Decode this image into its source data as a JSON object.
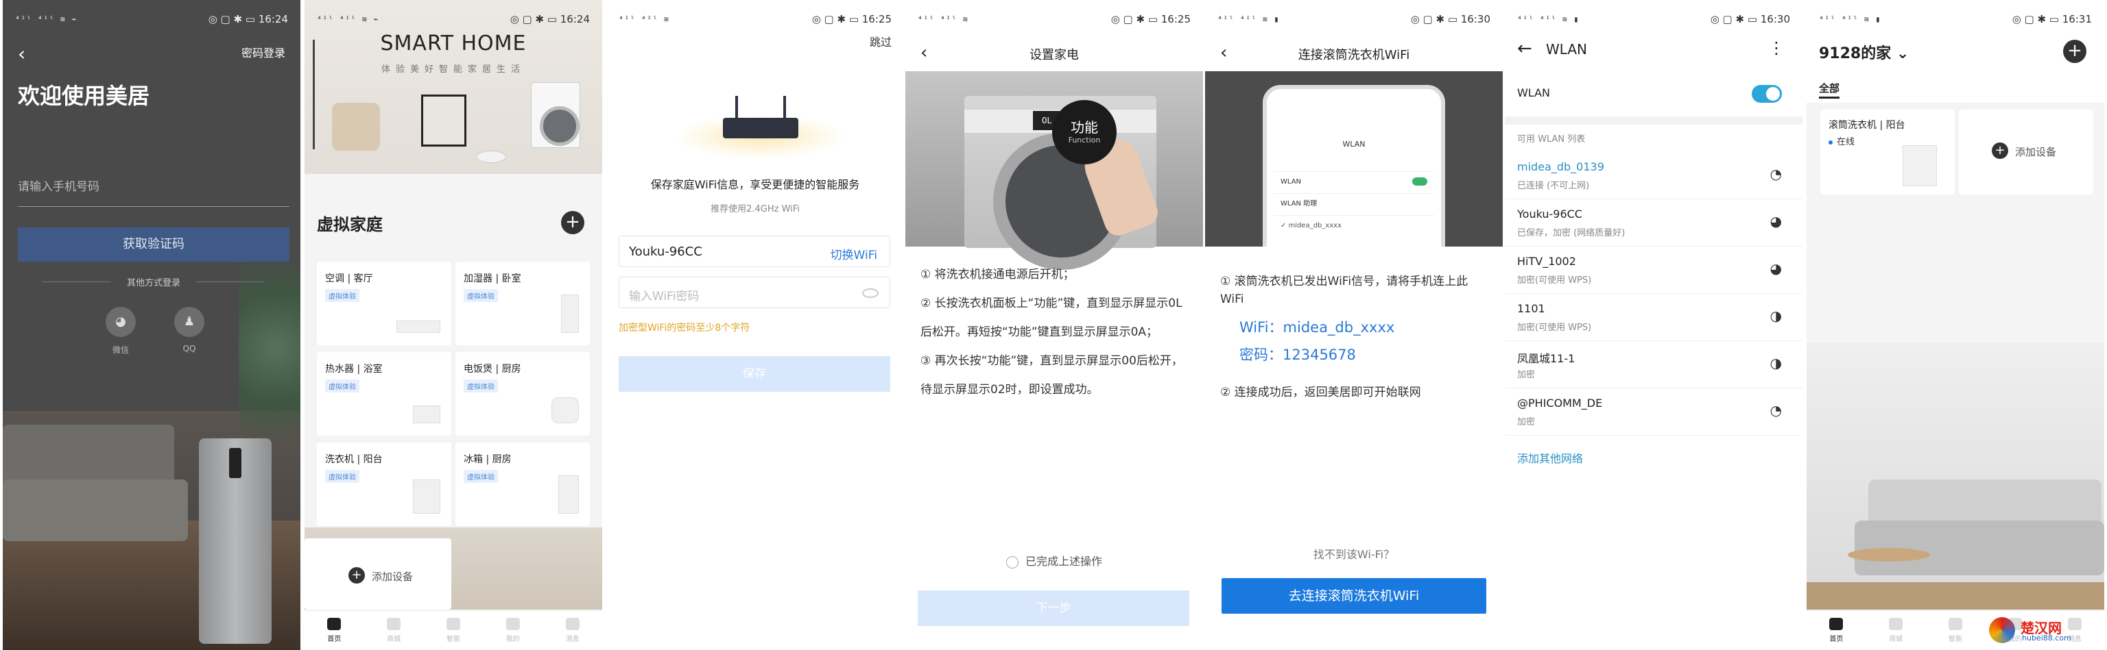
{
  "status_bars": {
    "p1": {
      "time": "16:24"
    },
    "p2": {
      "time": "16:24"
    },
    "p3": {
      "time": "16:25"
    },
    "p4": {
      "time": "16:25"
    },
    "p5": {
      "time": "16:30"
    },
    "p6": {
      "time": "16:30"
    },
    "p7": {
      "time": "16:31"
    }
  },
  "login": {
    "password_login": "密码登录",
    "welcome": "欢迎使用美居",
    "phone_placeholder": "请输入手机号码",
    "get_code": "获取验证码",
    "other_methods": "其他方式登录",
    "wechat": "微信",
    "qq": "QQ"
  },
  "home_virtual": {
    "hero_title": "SMART HOME",
    "hero_subtitle": "体验美好智能家居生活",
    "section_title": "虚拟家庭",
    "cards": [
      {
        "name": "空调 | 客厅",
        "tag": "虚拟体验"
      },
      {
        "name": "加湿器 | 卧室",
        "tag": "虚拟体验"
      },
      {
        "name": "热水器 | 浴室",
        "tag": "虚拟体验"
      },
      {
        "name": "电饭煲 | 厨房",
        "tag": "虚拟体验"
      },
      {
        "name": "洗衣机 | 阳台",
        "tag": "虚拟体验"
      },
      {
        "name": "冰箱 | 厨房",
        "tag": "虚拟体验"
      }
    ],
    "add_device": "添加设备",
    "tabs": [
      "首页",
      "商城",
      "智能",
      "我的",
      "消息"
    ]
  },
  "wifi_setup": {
    "skip": "跳过",
    "headline": "保存家庭WiFi信息，享受更便捷的智能服务",
    "sub": "推荐使用2.4GHz WiFi",
    "ssid": "Youku-96CC",
    "switch_wifi": "切换WiFi",
    "password_placeholder": "输入WiFi密码",
    "hint": "加密型WiFi的密码至少8个字符",
    "save": "保存"
  },
  "setup_appliance": {
    "title": "设置家电",
    "func_button_cn": "功能",
    "func_button_en": "Function",
    "display_code": "0L",
    "steps": [
      "① 将洗衣机接通电源后开机；",
      "② 长按洗衣机面板上“功能”键，直到显示屏显示0L后松开。再短按“功能”键直到显示屏显示0A；",
      "③ 再次长按“功能”键，直到显示屏显示00后松开，待显示屏显示02时，即设置成功。"
    ],
    "done_label": "已完成上述操作",
    "next": "下一步"
  },
  "connect_washer": {
    "title": "连接滚筒洗衣机WiFi",
    "phone_wlan": "WLAN",
    "phone_rows": [
      "WLAN",
      "WLAN 助理",
      "midea_db_xxxx"
    ],
    "step1": "① 滚筒洗衣机已发出WiFi信号，请将手机连上此WiFi",
    "wifi_line": "WiFi：midea_db_xxxx",
    "password_line": "密码：12345678",
    "step2": "② 连接成功后，返回美居即可开始联网",
    "not_found": "找不到该Wi-Fi？",
    "connect_button": "去连接滚筒洗衣机WiFi"
  },
  "wlan_settings": {
    "title": "WLAN",
    "toggle_label": "WLAN",
    "list_header": "可用 WLAN 列表",
    "networks": [
      {
        "name": "midea_db_0139",
        "status": "已连接 (不可上网)"
      },
      {
        "name": "Youku-96CC",
        "status": "已保存，加密 (网络质量好)"
      },
      {
        "name": "HiTV_1002",
        "status": "加密(可使用 WPS)"
      },
      {
        "name": "1101",
        "status": "加密(可使用 WPS)"
      },
      {
        "name": "凤凰城11-1",
        "status": "加密"
      },
      {
        "name": "@PHICOMM_DE",
        "status": "加密"
      }
    ],
    "add_other": "添加其他网络"
  },
  "my_home": {
    "title": "9128的家 ⌄",
    "tab_all": "全部",
    "device_name": "滚筒洗衣机 | 阳台",
    "device_status": "在线",
    "add_device": "添加设备",
    "tabs": [
      "首页",
      "商城",
      "智能",
      "我的",
      "消息"
    ],
    "watermark_title": "楚汉网",
    "watermark_url": "hubei88.com"
  }
}
